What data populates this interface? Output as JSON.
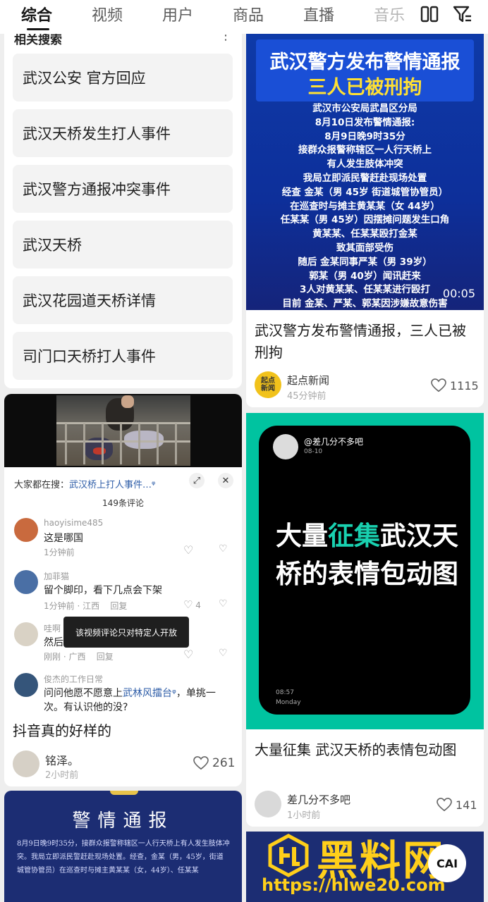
{
  "tabs": [
    {
      "label": "综合",
      "active": true
    },
    {
      "label": "视频"
    },
    {
      "label": "用户"
    },
    {
      "label": "商品"
    },
    {
      "label": "直播"
    },
    {
      "label": "音乐"
    }
  ],
  "toolbar": {
    "layout_icon": "layout-columns-icon",
    "filter_icon": "filter-icon"
  },
  "related": {
    "title": "相关搜索",
    "items": [
      "武汉公安 官方回应",
      "武汉天桥发生打人事件",
      "武汉警方通报冲突事件",
      "武汉天桥",
      "武汉花园道天桥详情",
      "司门口天桥打人事件"
    ]
  },
  "video_card": {
    "search_prefix": "大家都在搜：",
    "search_keyword": "武汉桥上打人事件…",
    "comment_count": "149条评论",
    "toast": "该视频评论只对特定人开放",
    "comments": [
      {
        "name": "haoyisime485",
        "text": "这是哪国",
        "meta": "1分钟前"
      },
      {
        "name": "加菲猫",
        "text": "留个脚印，看下几点会下架",
        "meta": "1分钟前 · 江西",
        "reply": "回复",
        "likes": "4"
      },
      {
        "name": "哇啊  表哥来了",
        "text": "然后呢",
        "meta": "刚刚 · 广西",
        "reply": "回复"
      },
      {
        "name": "俊杰的工作日常",
        "text_before": "问问他愿不愿意上",
        "link": "武林风擂台",
        "text_after": "，单挑一",
        "text_line2": "次。有认识他的没?"
      }
    ],
    "title": "抖音真的好样的",
    "author": "铭泽。",
    "time": "2小时前",
    "likes": "261"
  },
  "notice_card": {
    "title": "警情通报",
    "body": "8月9日晚9时35分，接群众报警称辖区一人行天桥上有人发生肢体冲突。我局立即派民警赶赴现场处置。经查，金某（男，45岁，街道城管协管员）在巡查时与摊主黄某某（女，44岁）、任某某"
  },
  "news_card": {
    "headline1": "武汉警方发布警情通报",
    "headline2": "三人已被刑拘",
    "lines": [
      "武汉市公安局武昌区分局",
      "8月10日发布警情通报:",
      "8月9日晚9时35分",
      "接群众报警称辖区一人行天桥上",
      "有人发生肢体冲突",
      "我局立即派民警赶赴现场处置",
      "经查 金某（男 45岁 街道城管协管员）",
      "在巡查时与摊主黄某某（女 44岁）",
      "任某某（男 45岁）因摆摊问题发生口角",
      "黄某某、任某某殴打金某",
      "致其面部受伤",
      "随后 金某同事严某（男 39岁）",
      "郭某（男 40岁）闻讯赶来",
      "3人对黄某某、任某某进行殴打",
      "目前 金某、严某、郭某因涉嫌故意伤害"
    ],
    "duration": "00:05",
    "title": "武汉警方发布警情通报，三人已被刑拘",
    "author": "起点新闻",
    "avatar_text": "起点新闻",
    "time": "45分钟前",
    "likes": "1115"
  },
  "meme_card": {
    "handle": "@差几分不多吧",
    "date": "08-10",
    "big_1": "大量",
    "big_hl": "征集",
    "big_2": "武汉天桥的表情包动图",
    "clock": "08:57",
    "day": "Monday",
    "title": "大量征集 武汉天桥的表情包动图",
    "author": "差几分不多吧",
    "time": "1小时前",
    "likes": "141"
  },
  "watermark": {
    "text": "黑料网",
    "url": "https://hlwe20.com",
    "badge": "CAI"
  },
  "colors": {
    "news_blue": "#0e3aa8",
    "meme_teal": "#00c3a0",
    "notice_navy": "#1c2d73",
    "watermark_gold": "#ffcf1a"
  }
}
